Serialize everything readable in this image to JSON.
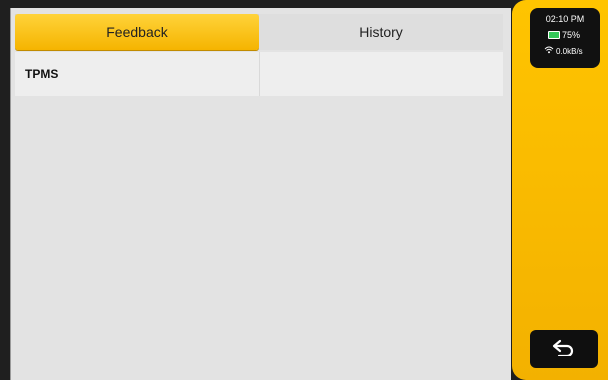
{
  "tabs": [
    {
      "label": "Feedback",
      "active": true
    },
    {
      "label": "History",
      "active": false
    }
  ],
  "list": {
    "items": [
      {
        "label": "TPMS"
      }
    ]
  },
  "status": {
    "time": "02:10 PM",
    "battery": "75%",
    "network": "0.0kB/s"
  },
  "icons": {
    "back": "back-icon",
    "battery": "battery-icon",
    "wifi": "wifi-icon"
  },
  "colors": {
    "accent": "#f5b400",
    "sidebar": "#ffc400"
  }
}
